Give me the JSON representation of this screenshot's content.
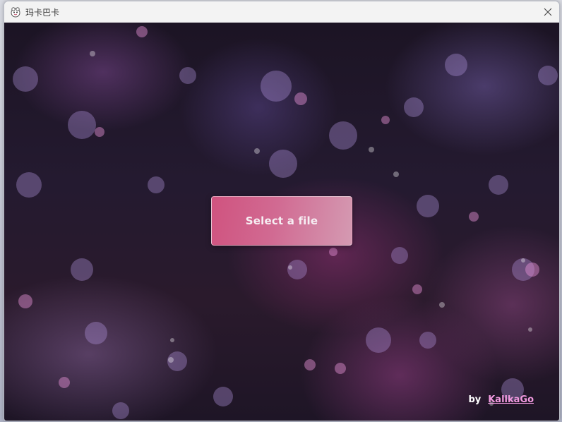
{
  "window": {
    "title": "玛卡巴卡",
    "app_icon": "mascot-face-icon",
    "close_icon": "close-icon"
  },
  "main": {
    "select_button_label": "Select a file",
    "credit_prefix": "by",
    "credit_link_text": "KallkaGo"
  },
  "colors": {
    "button_start": "#d0537f",
    "button_end": "#d49ab2",
    "link": "#f29ae0",
    "background_dark": "#1c1424"
  }
}
